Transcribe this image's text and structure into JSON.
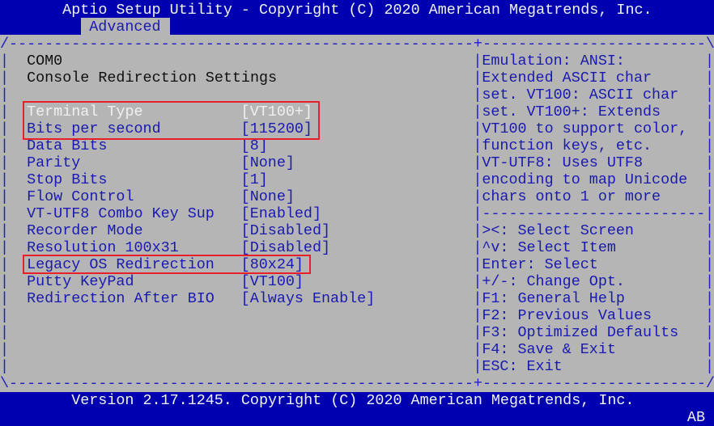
{
  "header": {
    "title": "Aptio Setup Utility - Copyright (C) 2020 American Megatrends, Inc.",
    "active_tab": "Advanced"
  },
  "main": {
    "port": "COM0",
    "section_title": "Console Redirection Settings",
    "items": [
      {
        "label": "Terminal Type",
        "value": "[VT100+]",
        "selected": true
      },
      {
        "label": "Bits per second",
        "value": "[115200]"
      },
      {
        "label": "Data Bits",
        "value": "[8]"
      },
      {
        "label": "Parity",
        "value": "[None]"
      },
      {
        "label": "Stop Bits",
        "value": "[1]"
      },
      {
        "label": "Flow Control",
        "value": "[None]"
      },
      {
        "label": "VT-UTF8 Combo Key Sup",
        "value": "[Enabled]"
      },
      {
        "label": "Recorder Mode",
        "value": "[Disabled]"
      },
      {
        "label": "Resolution 100x31",
        "value": "[Disabled]"
      },
      {
        "label": "Legacy OS Redirection",
        "value": "[80x24]"
      },
      {
        "label": "Putty KeyPad",
        "value": "[VT100]"
      },
      {
        "label": "Redirection After BIO",
        "value": "[Always Enable]"
      }
    ]
  },
  "help": {
    "lines": [
      "Emulation: ANSI:",
      "Extended ASCII char",
      "set. VT100: ASCII char",
      "set. VT100+: Extends",
      "VT100 to support color,",
      "function keys, etc.",
      "VT-UTF8: Uses UTF8",
      "encoding to map Unicode",
      "chars onto 1 or more"
    ],
    "keys": [
      "><: Select Screen",
      "^v: Select Item",
      "Enter: Select",
      "+/-: Change Opt.",
      "F1: General Help",
      "F2: Previous Values",
      "F3: Optimized Defaults",
      "F4: Save & Exit",
      "ESC: Exit"
    ]
  },
  "footer": {
    "version": "Version 2.17.1245. Copyright (C) 2020 American Megatrends, Inc.",
    "badge": "AB"
  },
  "colors": {
    "bar": "#0000b0",
    "background": "#b5b5b5",
    "text": "#1a1ab0",
    "selected": "#f0f0f0",
    "highlight_box": "#e8202a"
  }
}
